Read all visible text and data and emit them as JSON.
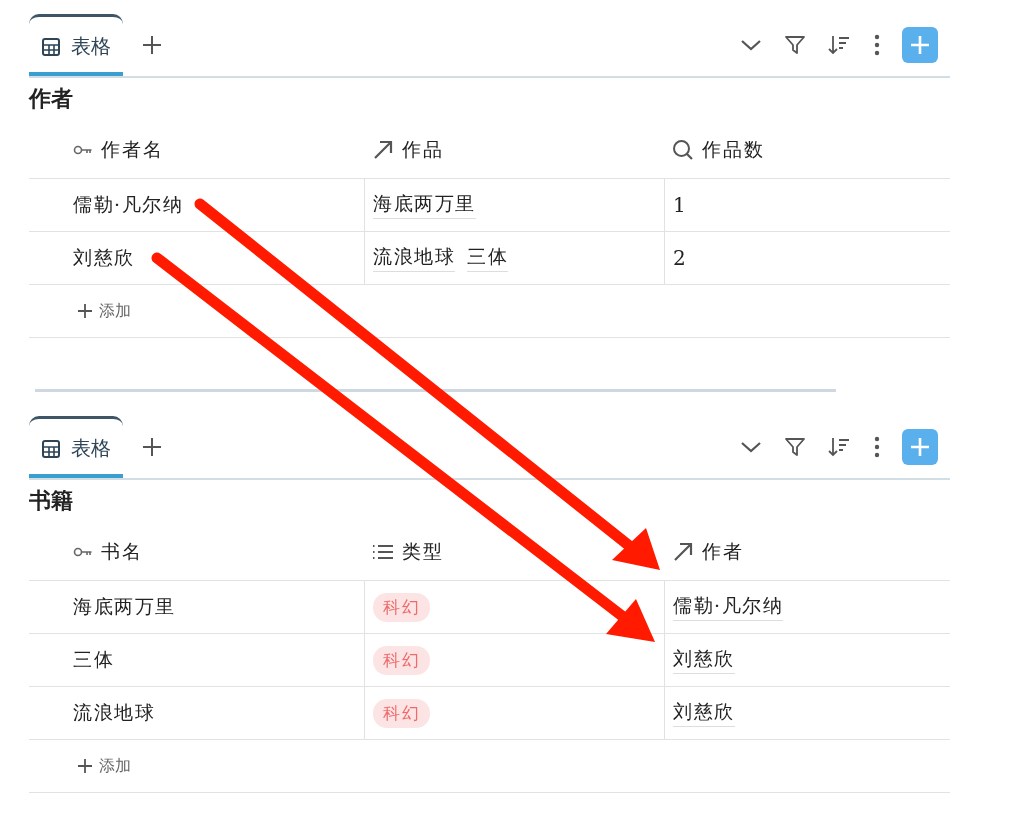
{
  "databases": [
    {
      "tabs": [
        {
          "label": "表格",
          "selected": true
        }
      ],
      "title": "作者",
      "columns": [
        {
          "kind": "primary",
          "label": "作者名"
        },
        {
          "kind": "relation",
          "label": "作品"
        },
        {
          "kind": "formula",
          "label": "作品数"
        }
      ],
      "rows": [
        {
          "cells": [
            {
              "kind": "text",
              "text": "儒勒·凡尔纳"
            },
            {
              "kind": "links",
              "links": [
                "海底两万里"
              ]
            },
            {
              "kind": "number",
              "text": "1"
            }
          ]
        },
        {
          "cells": [
            {
              "kind": "text",
              "text": "刘慈欣"
            },
            {
              "kind": "links",
              "links": [
                "流浪地球",
                "三体"
              ]
            },
            {
              "kind": "number",
              "text": "2"
            }
          ]
        }
      ],
      "add_label": "添加"
    },
    {
      "tabs": [
        {
          "label": "表格",
          "selected": true
        }
      ],
      "title": "书籍",
      "columns": [
        {
          "kind": "primary",
          "label": "书名"
        },
        {
          "kind": "select",
          "label": "类型"
        },
        {
          "kind": "relation",
          "label": "作者"
        }
      ],
      "rows": [
        {
          "cells": [
            {
              "kind": "text",
              "text": "海底两万里"
            },
            {
              "kind": "tag",
              "text": "科幻"
            },
            {
              "kind": "links",
              "links": [
                "儒勒·凡尔纳"
              ]
            }
          ]
        },
        {
          "cells": [
            {
              "kind": "text",
              "text": "三体"
            },
            {
              "kind": "tag",
              "text": "科幻"
            },
            {
              "kind": "links",
              "links": [
                "刘慈欣"
              ]
            }
          ]
        },
        {
          "cells": [
            {
              "kind": "text",
              "text": "流浪地球"
            },
            {
              "kind": "tag",
              "text": "科幻"
            },
            {
              "kind": "links",
              "links": [
                "刘慈欣"
              ]
            }
          ]
        }
      ],
      "add_label": "添加"
    }
  ]
}
